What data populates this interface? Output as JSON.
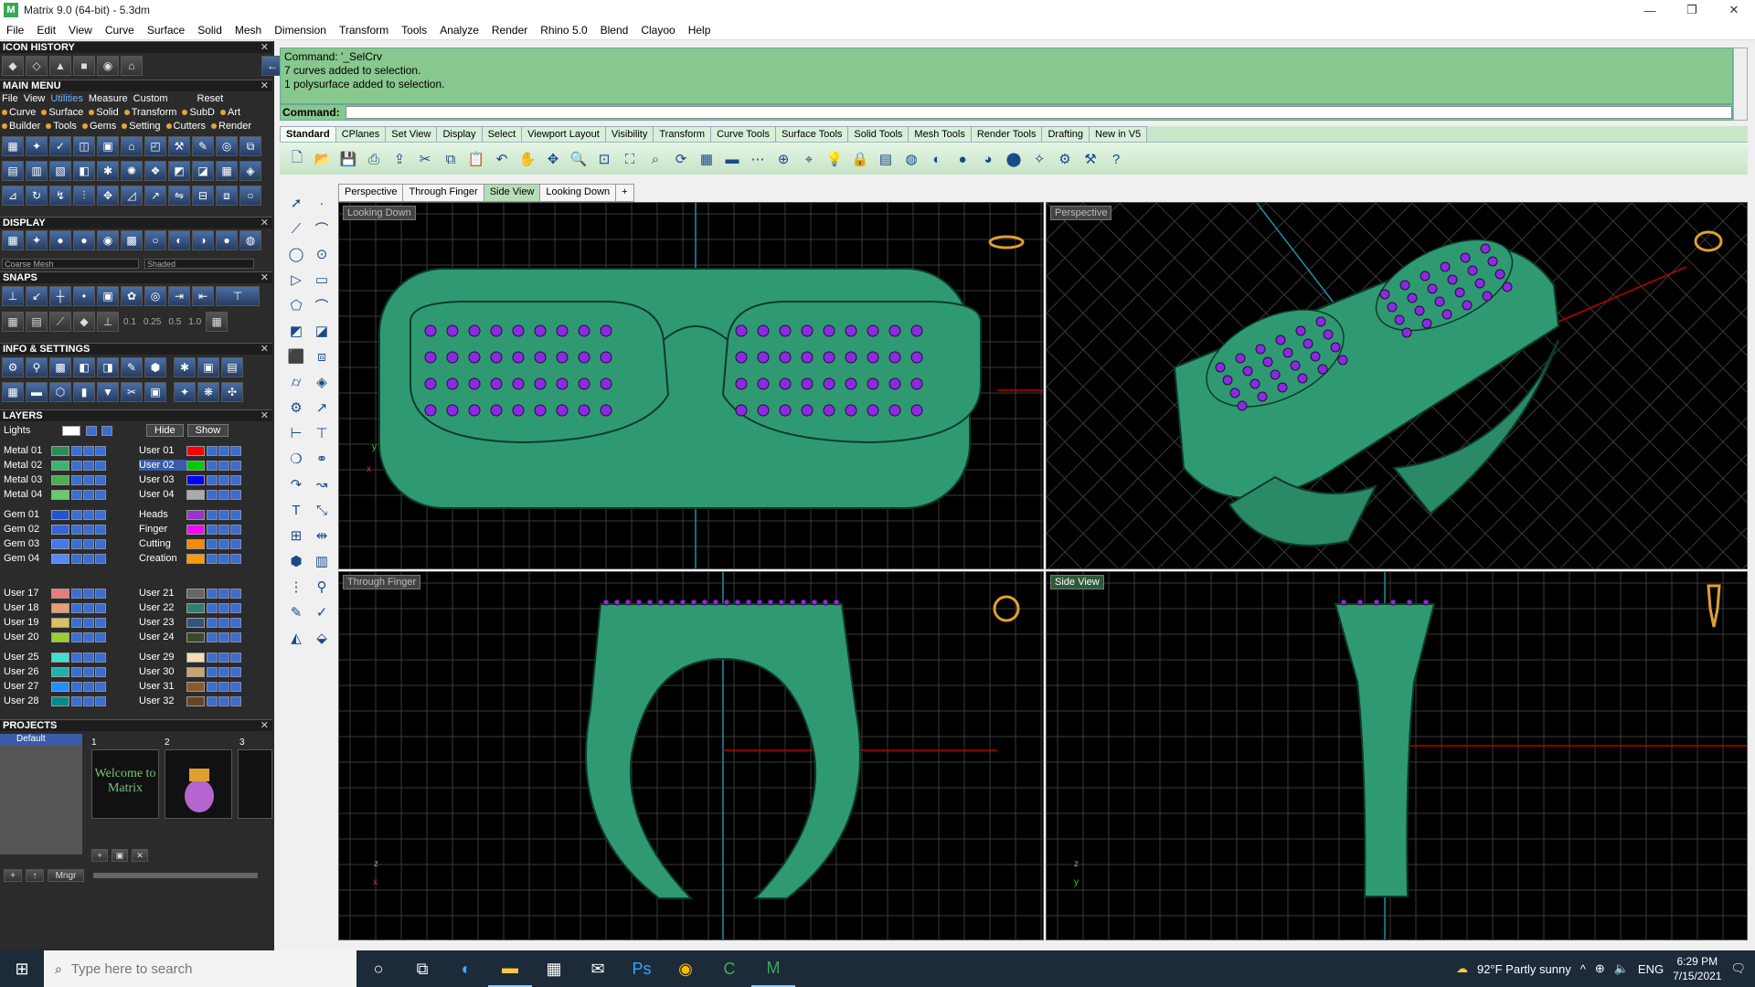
{
  "window": {
    "title": "Matrix 9.0 (64-bit) - 5.3dm",
    "controls": [
      "—",
      "❐",
      "✕"
    ]
  },
  "menu": [
    "File",
    "Edit",
    "View",
    "Curve",
    "Surface",
    "Solid",
    "Mesh",
    "Dimension",
    "Transform",
    "Tools",
    "Analyze",
    "Render",
    "Rhino 5.0",
    "Blend",
    "Clayoo",
    "Help"
  ],
  "panels": {
    "icon_history": "ICON HISTORY",
    "main_menu": "MAIN MENU",
    "display": "DISPLAY",
    "snaps": "SNAPS",
    "info_settings": "INFO & SETTINGS",
    "layers": "LAYERS",
    "projects": "PROJECTS"
  },
  "main_menu": {
    "row1": [
      "File",
      "View",
      "Utilities",
      "Measure",
      "Custom",
      "Reset"
    ],
    "row2": [
      "Curve",
      "Surface",
      "Solid",
      "Transform",
      "SubD",
      "Art"
    ],
    "row3": [
      "Builder",
      "Tools",
      "Gems",
      "Setting",
      "Cutters",
      "Render"
    ]
  },
  "display": {
    "mesh": "Coarse Mesh",
    "mode": "Shaded"
  },
  "snaps": {
    "values": [
      "0.1",
      "0.25",
      "0.5",
      "1.0"
    ]
  },
  "layers": {
    "lights": "Lights",
    "hide": "Hide",
    "show": "Show",
    "left": [
      {
        "name": "Metal 01",
        "color": "#2e8b57"
      },
      {
        "name": "Metal 02",
        "color": "#3cb371"
      },
      {
        "name": "Metal 03",
        "color": "#4caf50"
      },
      {
        "name": "Metal 04",
        "color": "#66cc66"
      },
      {
        "name": "Gem 01",
        "color": "#2255cc"
      },
      {
        "name": "Gem 02",
        "color": "#3366dd"
      },
      {
        "name": "Gem 03",
        "color": "#4477ee"
      },
      {
        "name": "Gem 04",
        "color": "#5588ff"
      },
      {
        "name": "User 17",
        "color": "#e87a7a"
      },
      {
        "name": "User 18",
        "color": "#e8a070"
      },
      {
        "name": "User 19",
        "color": "#d9c060"
      },
      {
        "name": "User 20",
        "color": "#9acd32"
      },
      {
        "name": "User 25",
        "color": "#40e0d0"
      },
      {
        "name": "User 26",
        "color": "#20b2aa"
      },
      {
        "name": "User 27",
        "color": "#1e90ff"
      },
      {
        "name": "User 28",
        "color": "#008b8b"
      }
    ],
    "right": [
      {
        "name": "User 01",
        "color": "#ff0000"
      },
      {
        "name": "User 02",
        "color": "#00cc00"
      },
      {
        "name": "User 03",
        "color": "#0000ff"
      },
      {
        "name": "User 04",
        "color": "#aaaaaa"
      },
      {
        "name": "Heads",
        "color": "#9933cc"
      },
      {
        "name": "Finger",
        "color": "#ff00ff"
      },
      {
        "name": "Cutting",
        "color": "#ff8800"
      },
      {
        "name": "Creation",
        "color": "#ff9900"
      },
      {
        "name": "User 21",
        "color": "#666666"
      },
      {
        "name": "User 22",
        "color": "#2f7f6f"
      },
      {
        "name": "User 23",
        "color": "#335577"
      },
      {
        "name": "User 24",
        "color": "#3b4a2a"
      },
      {
        "name": "User 29",
        "color": "#f5deb3"
      },
      {
        "name": "User 30",
        "color": "#c8a46e"
      },
      {
        "name": "User 31",
        "color": "#8b5a2b"
      },
      {
        "name": "User 32",
        "color": "#6b4423"
      }
    ]
  },
  "projects": {
    "default": "Default",
    "thumbs": [
      "1",
      "2",
      "3"
    ],
    "welcome": "Welcome to Matrix",
    "mgr": "Mngr"
  },
  "command": {
    "history": [
      "Command: '_SelCrv",
      "7 curves added to selection.",
      "1 polysurface added to selection."
    ],
    "prompt": "Command:",
    "value": ""
  },
  "tool_tabs": [
    "Standard",
    "CPlanes",
    "Set View",
    "Display",
    "Select",
    "Viewport Layout",
    "Visibility",
    "Transform",
    "Curve Tools",
    "Surface Tools",
    "Solid Tools",
    "Mesh Tools",
    "Render Tools",
    "Drafting",
    "New in V5"
  ],
  "viewport_tabs": [
    "Perspective",
    "Through Finger",
    "Side View",
    "Looking Down",
    "+"
  ],
  "viewports": {
    "top_left": "Looking Down",
    "top_right": "Perspective",
    "bottom_left": "Through Finger",
    "bottom_right": "Side View"
  },
  "axes": {
    "x": "x",
    "y": "y",
    "z": "z"
  },
  "colors": {
    "model": "#2e8b6a",
    "gem": "#8a2be2",
    "grid": "#555555",
    "command_bg": "#88c78e"
  },
  "taskbar": {
    "search_placeholder": "Type here to search",
    "weather": "92°F  Partly sunny",
    "lang": "ENG",
    "time": "6:29 PM",
    "date": "7/15/2021"
  }
}
